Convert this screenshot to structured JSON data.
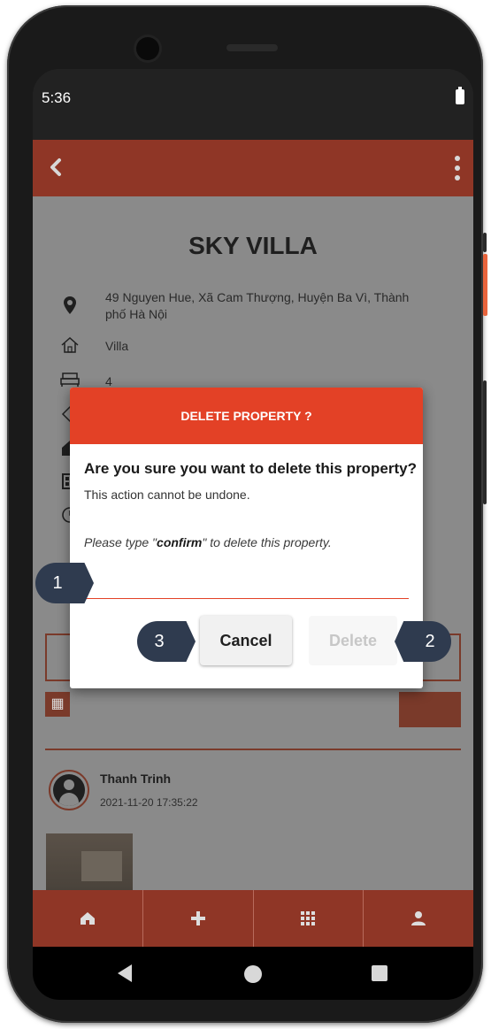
{
  "status_bar": {
    "time": "5:36"
  },
  "property": {
    "title": "SKY VILLA",
    "address": "49 Nguyen Hue, Xã Cam Thượng, Huyện Ba Vì, Thành phố Hà Nội",
    "type": "Villa",
    "bedrooms": "4"
  },
  "comment": {
    "author": "Thanh Trinh",
    "date": "2021-11-20 17:35:22"
  },
  "dialog": {
    "title": "DELETE PROPERTY ?",
    "question": "Are you sure you want to delete this property?",
    "note": "This action cannot be undone.",
    "hint_prefix": "Please type \"",
    "hint_keyword": "confirm",
    "hint_suffix": "\" to delete this property.",
    "input_value": "",
    "cancel_label": "Cancel",
    "delete_label": "Delete"
  },
  "callouts": {
    "one": "1",
    "two": "2",
    "three": "3"
  },
  "colors": {
    "header": "#e34126",
    "appbar": "#8f3626",
    "overlay": "#8a8a8a",
    "callout": "#2f3b4f"
  },
  "icons": {
    "appbar": [
      "back-icon",
      "more-vert-icon"
    ],
    "details": [
      "location-pin-icon",
      "house-icon",
      "bed-icon",
      "price-tag-icon",
      "home-icon",
      "calendar-icon",
      "clock-icon"
    ],
    "bottom_nav": [
      "home-icon",
      "add-icon",
      "grid-icon",
      "user-icon"
    ]
  }
}
